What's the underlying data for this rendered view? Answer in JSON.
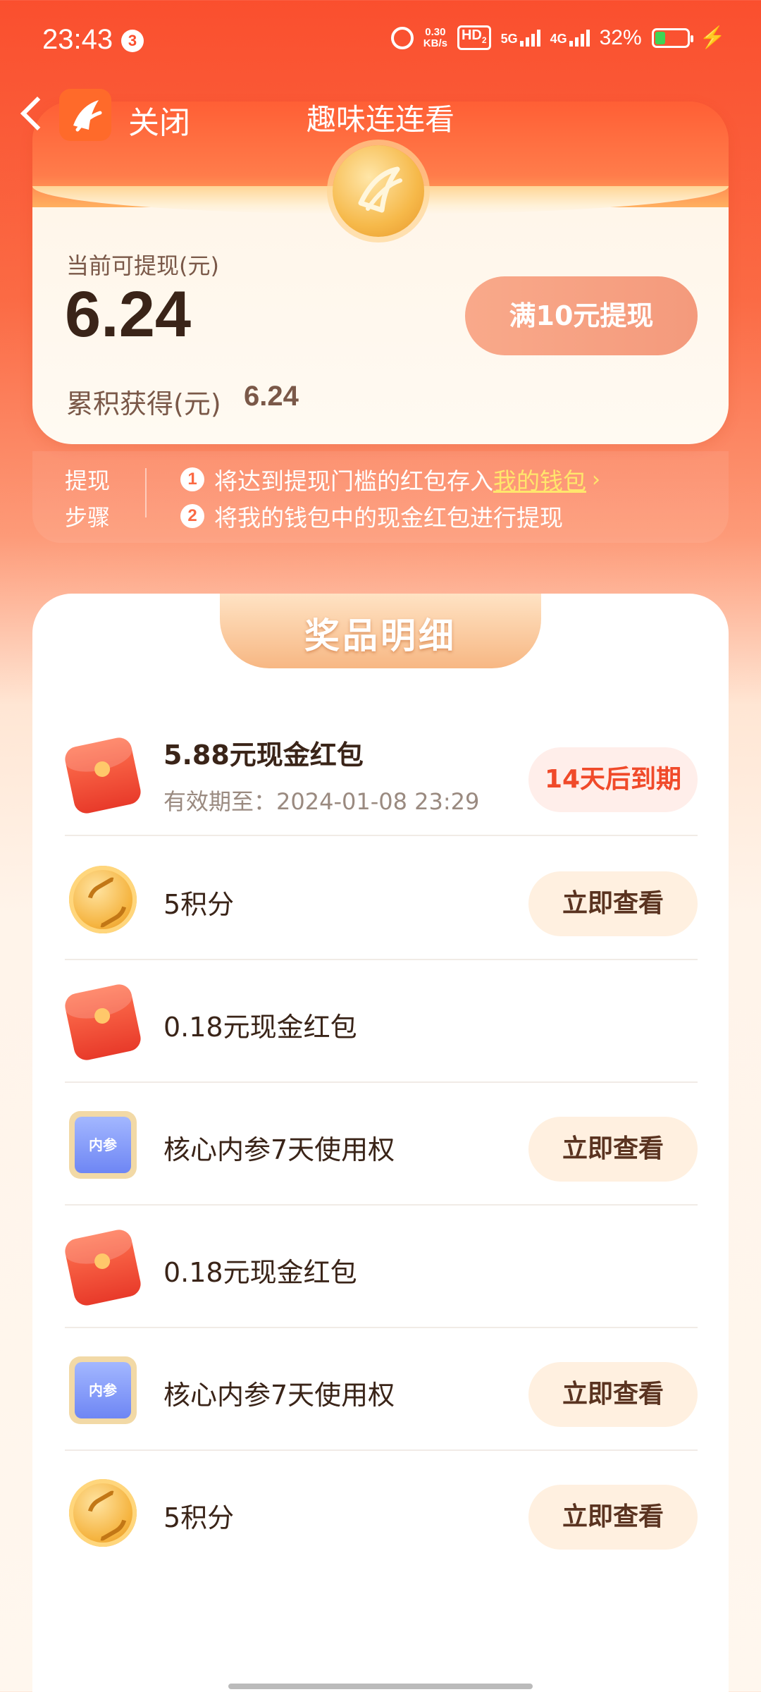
{
  "status_bar": {
    "time": "23:43",
    "notification_count": "3",
    "net_speed_value": "0.30",
    "net_speed_unit": "KB/s",
    "hd_label": "HD",
    "hd_sub": "2",
    "net1": "5G",
    "net2": "4G",
    "battery_pct": "32%",
    "battery_level": 0.32,
    "alarm_icon": "alarm-icon",
    "charging_icon": "bolt-icon"
  },
  "nav": {
    "back_icon": "chevron-left-icon",
    "close_label": "关闭",
    "title": "趣味连连看"
  },
  "balance": {
    "label": "当前可提现(元)",
    "amount": "6.24",
    "withdraw_button": "满10元提现",
    "cumulative_label": "累积获得(元)",
    "cumulative_value": "6.24"
  },
  "steps": {
    "label_line1": "提现",
    "label_line2": "步骤",
    "step1_num": "1",
    "step1_text": "将达到提现门槛的红包存入",
    "step1_link": "我的钱包",
    "step1_chevron": "›",
    "step2_num": "2",
    "step2_text": "将我的钱包中的现金红包进行提现"
  },
  "prizes": {
    "title": "奖品明细",
    "items": [
      {
        "icon": "red-envelope-icon",
        "name": "5.88元现金红包",
        "expiry": "有效期至：2024-01-08 23:29",
        "action": "14天后到期"
      },
      {
        "icon": "coin-icon",
        "name": "5积分",
        "action": "立即查看"
      },
      {
        "icon": "red-envelope-icon",
        "name": "0.18元现金红包"
      },
      {
        "icon": "book-icon",
        "icon_text": "内参",
        "name": "核心内参7天使用权",
        "action": "立即查看"
      },
      {
        "icon": "red-envelope-icon",
        "name": "0.18元现金红包"
      },
      {
        "icon": "book-icon",
        "icon_text": "内参",
        "name": "核心内参7天使用权",
        "action": "立即查看"
      },
      {
        "icon": "coin-icon",
        "name": "5积分",
        "action": "立即查看"
      }
    ]
  },
  "colors": {
    "brand": "#fa4f2e",
    "action_bg": "#fff0e0",
    "expire_text": "#f04a2a",
    "link": "#ffe66c"
  }
}
